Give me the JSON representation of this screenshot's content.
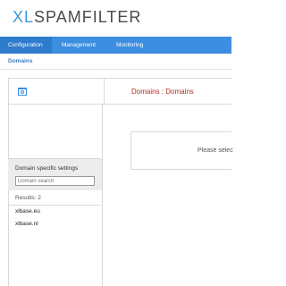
{
  "logo": {
    "prefix": "XL",
    "rest": "SPAMFILTER"
  },
  "nav": {
    "items": [
      {
        "label": "Configuration",
        "active": true
      },
      {
        "label": "Management",
        "active": false
      },
      {
        "label": "Monitoring",
        "active": false
      }
    ]
  },
  "breadcrumb": {
    "current": "Domains"
  },
  "header": {
    "title": "Domains : Domains",
    "icon": "view-icon"
  },
  "sidebar": {
    "title": "Domain specific settings",
    "search_placeholder": "Domain search",
    "results_label": "Results: 2",
    "domains": [
      "xlbase.eu",
      "xlbase.nl"
    ]
  },
  "main": {
    "message": "Please selec"
  },
  "colors": {
    "accent": "#3d8ee0",
    "title_red": "#b22a1f",
    "logo_blue": "#3b97d8"
  }
}
